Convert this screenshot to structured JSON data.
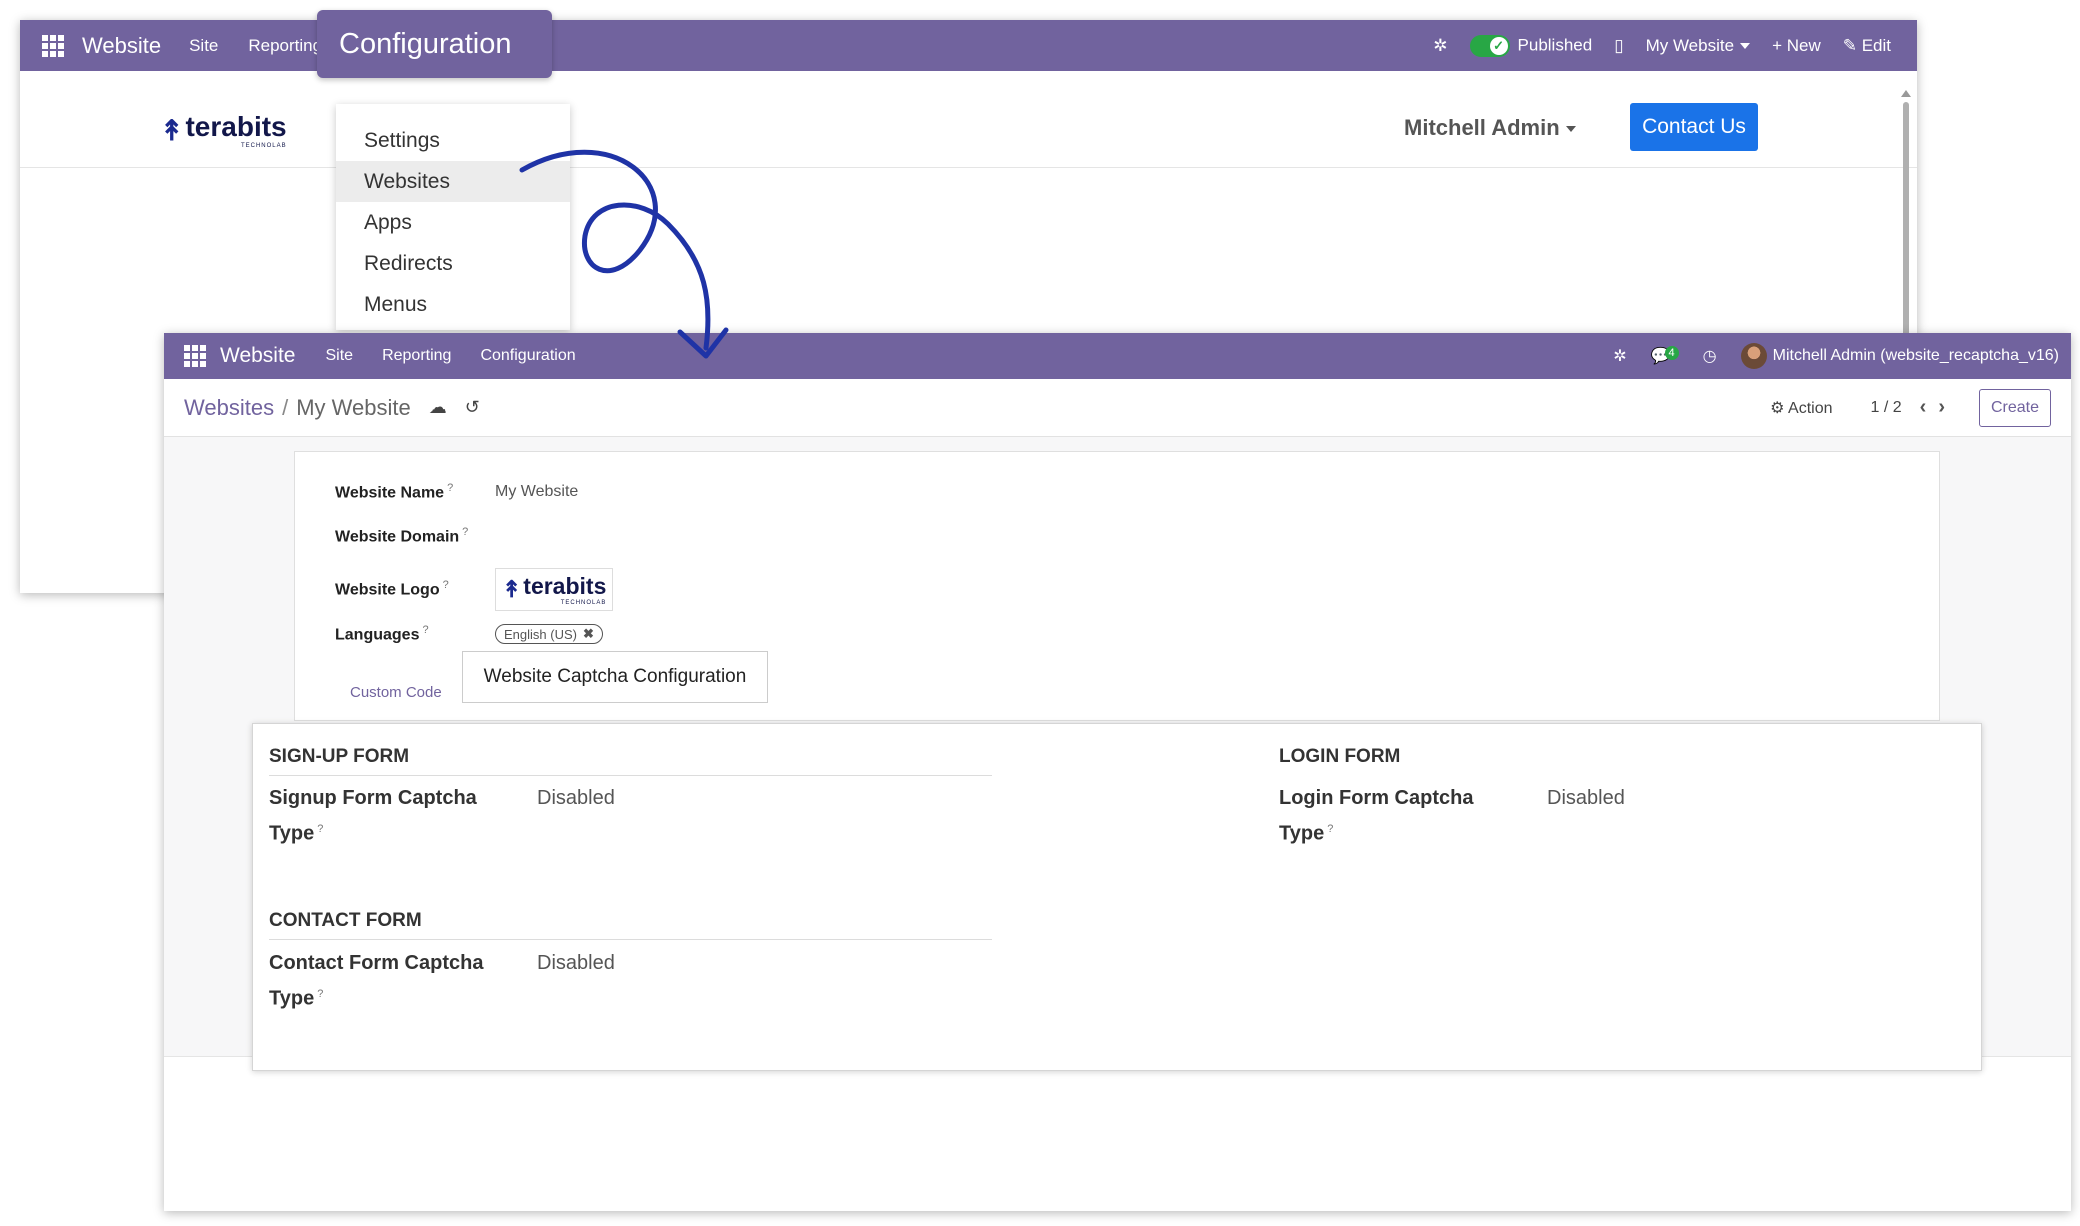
{
  "back_window": {
    "topbar": {
      "app_name": "Website",
      "menu": [
        "Site",
        "Reporting",
        "Configuration"
      ],
      "published_label": "Published",
      "website_selector": "My Website",
      "new_label": "New",
      "edit_label": "Edit"
    },
    "header": {
      "logo_text": "terabits",
      "logo_subtext": "TECHNOLAB",
      "user": "Mitchell Admin",
      "contact_button": "Contact Us"
    },
    "configuration_dropdown": {
      "items": [
        "Settings",
        "Websites",
        "Apps",
        "Redirects",
        "Menus"
      ],
      "highlighted": "Websites"
    }
  },
  "front_window": {
    "topbar": {
      "app_name": "Website",
      "menu": [
        "Site",
        "Reporting",
        "Configuration"
      ],
      "message_count": "4",
      "user": "Mitchell Admin (website_recaptcha_v16)"
    },
    "control_panel": {
      "breadcrumb_parent": "Websites",
      "breadcrumb_separator": "/",
      "breadcrumb_current": "My Website",
      "action_label": "Action",
      "pager": "1 / 2",
      "create_button": "Create"
    },
    "form": {
      "website_name_label": "Website Name",
      "website_name_value": "My Website",
      "website_domain_label": "Website Domain",
      "website_logo_label": "Website Logo",
      "logo_text": "terabits",
      "logo_subtext": "TECHNOLAB",
      "languages_label": "Languages",
      "language_tag": "English (US)",
      "tooltip_marker": "?"
    },
    "tabs": {
      "custom_code": "Custom Code",
      "captcha_config": "Website Captcha Configuration"
    },
    "captcha_panel": {
      "signup_title": "SIGN-UP FORM",
      "signup_label_line1": "Signup Form Captcha",
      "signup_label_line2": "Type",
      "signup_value": "Disabled",
      "login_title": "LOGIN FORM",
      "login_label_line1": "Login Form Captcha",
      "login_label_line2": "Type",
      "login_value": "Disabled",
      "contact_title": "CONTACT FORM",
      "contact_label_line1": "Contact Form Captcha",
      "contact_label_line2": "Type",
      "contact_value": "Disabled"
    }
  },
  "colors": {
    "topbar": "#71639e",
    "contact_button": "#1a73e8",
    "arrow": "#1f33a6",
    "toggle_on": "#28a745"
  }
}
